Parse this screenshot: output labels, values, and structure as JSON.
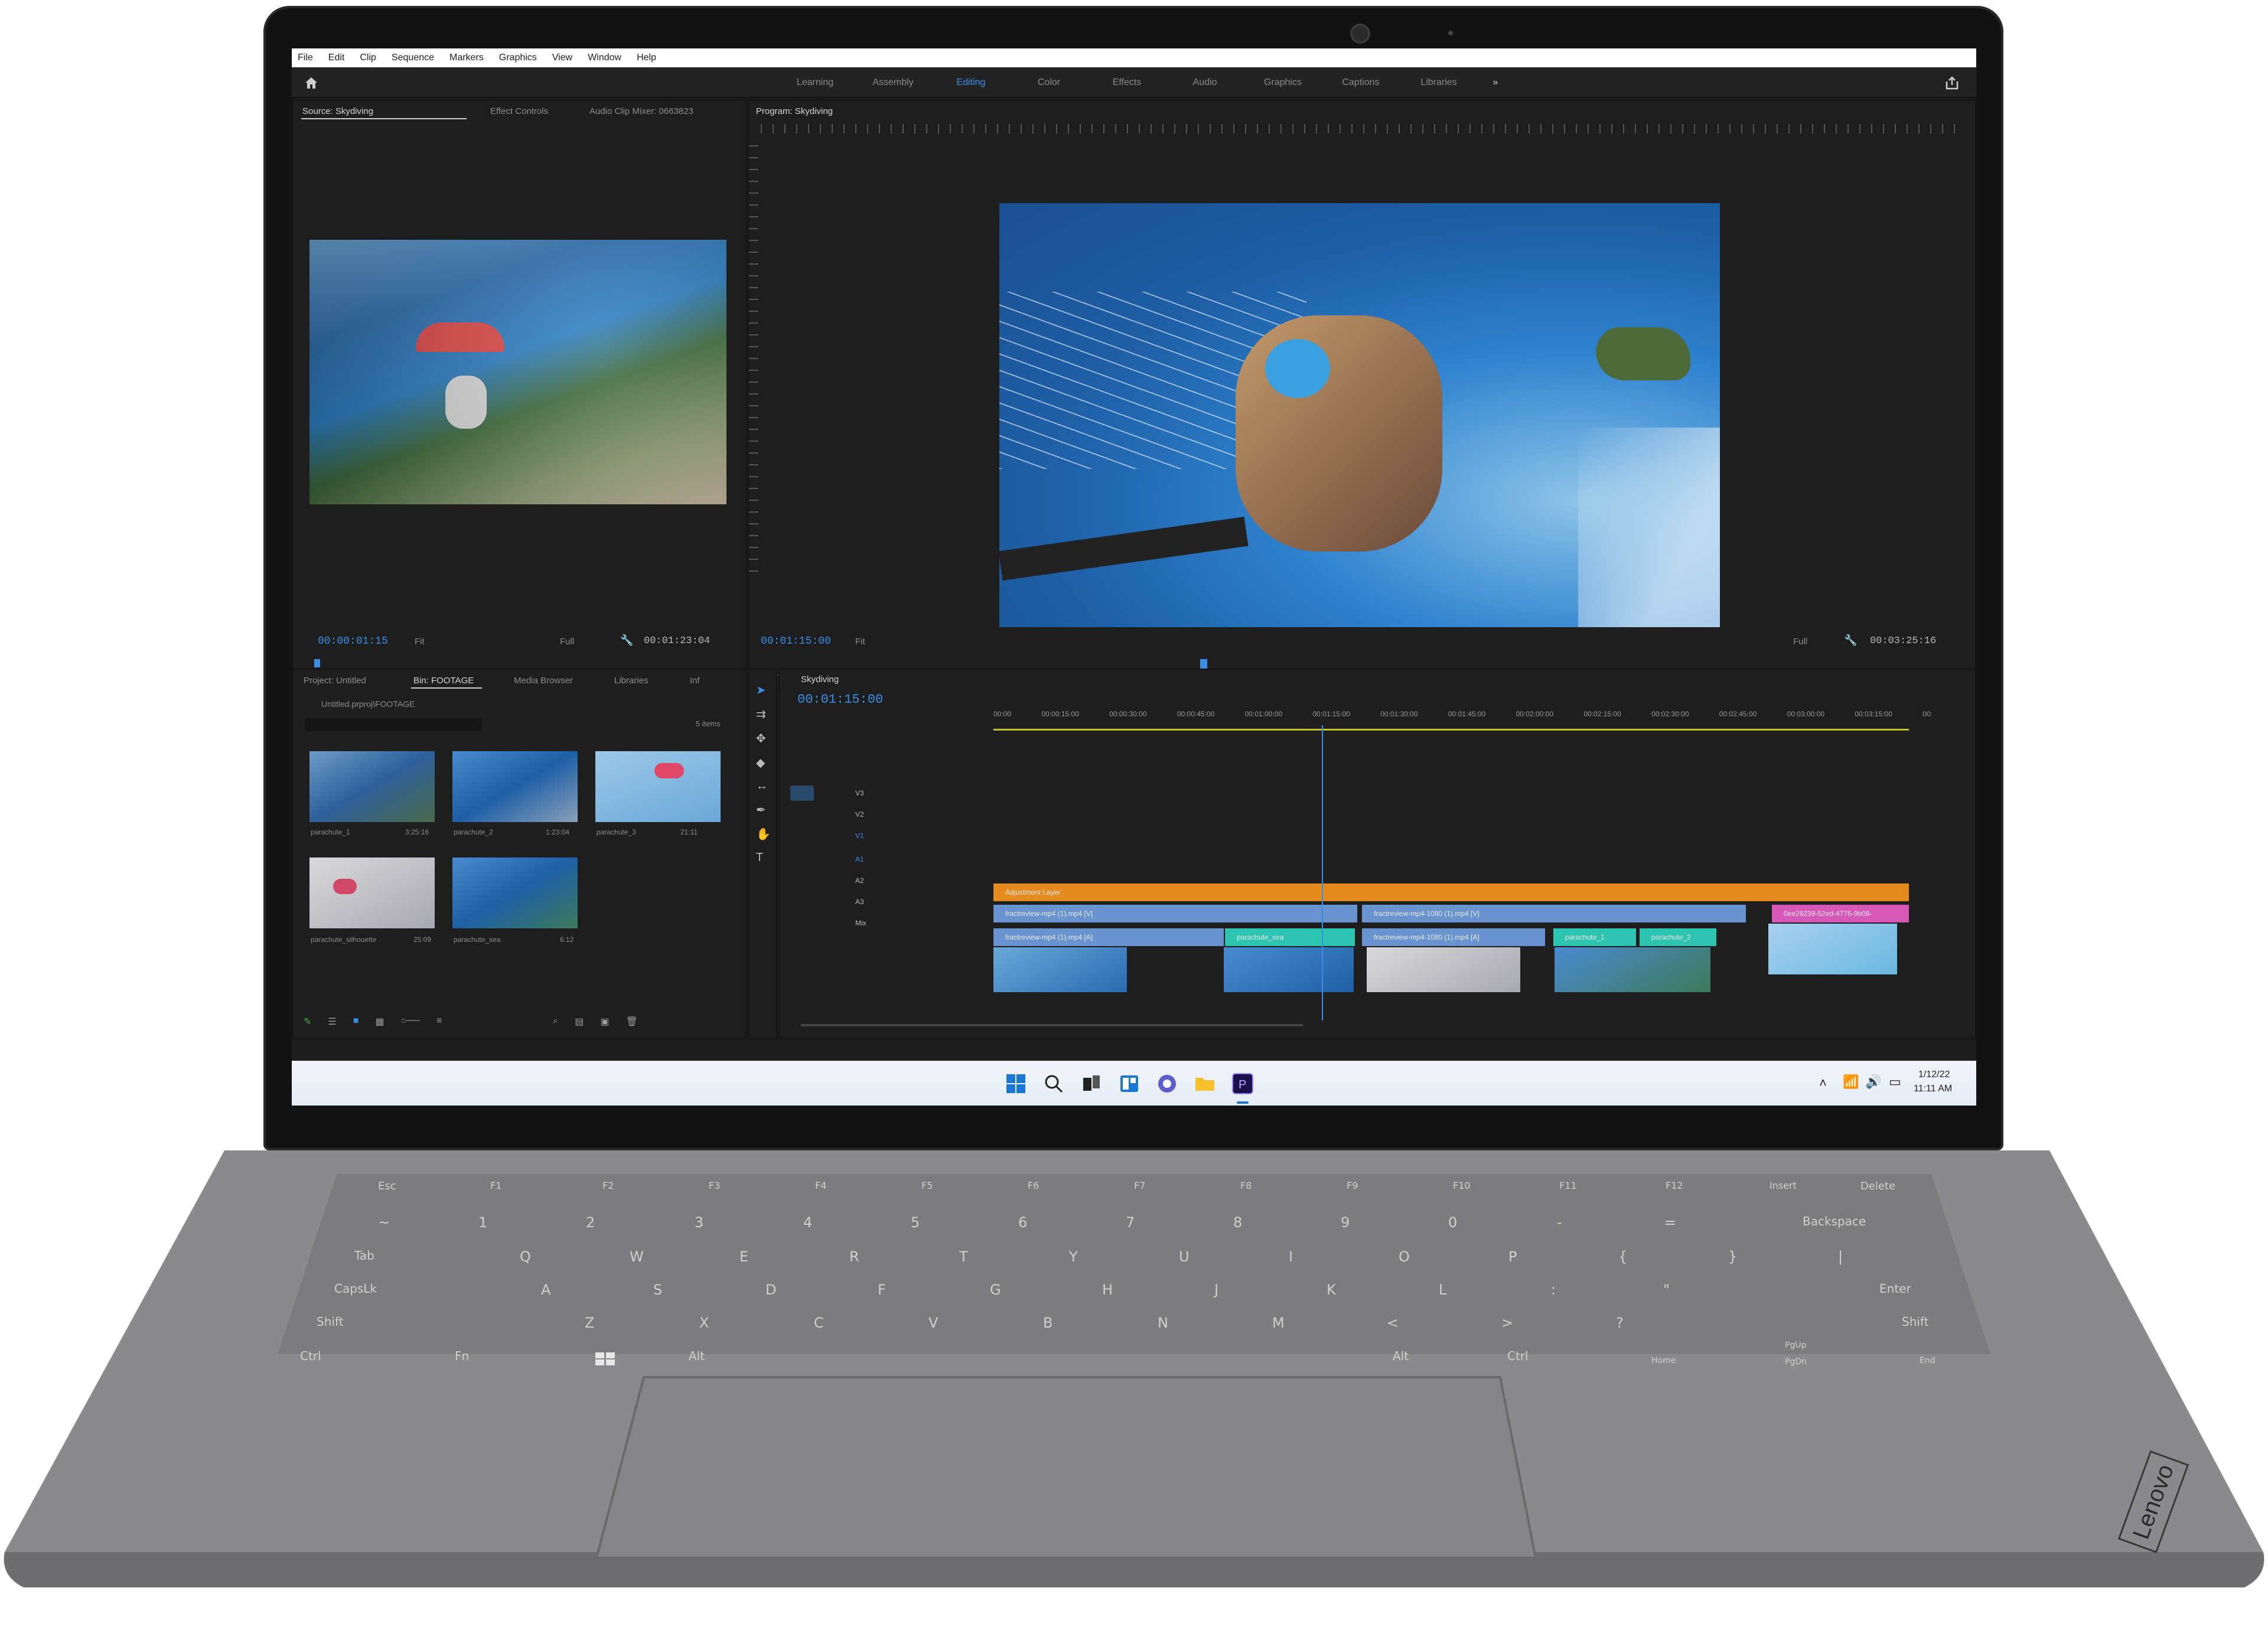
{
  "menu": [
    "File",
    "Edit",
    "Clip",
    "Sequence",
    "Markers",
    "Graphics",
    "View",
    "Window",
    "Help"
  ],
  "workspaces": [
    "Learning",
    "Assembly",
    "Editing",
    "Color",
    "Effects",
    "Audio",
    "Graphics",
    "Captions",
    "Libraries"
  ],
  "workspace_active": "Editing",
  "source_panel": {
    "tabs": [
      "Source: Skydiving",
      "Effect Controls",
      "Audio Clip Mixer: 0663823"
    ],
    "timecode": "00:00:01:15",
    "fit": "Fit",
    "quality": "Full",
    "duration": "00:01:23:04"
  },
  "program_panel": {
    "tab": "Program: Skydiving",
    "timecode": "00:01:15:00",
    "fit": "Fit",
    "quality": "Full",
    "duration": "00:03:25:16"
  },
  "project_panel": {
    "tabs": [
      "Project: Untitled",
      "Bin: FOOTAGE",
      "Media Browser",
      "Libraries",
      "Inf"
    ],
    "path": "Untitled.prproj\\FOOTAGE",
    "item_count": "5 items",
    "items": [
      {
        "name": "parachute_1",
        "duration": "3:25:16"
      },
      {
        "name": "parachute_2",
        "duration": "1:23:04"
      },
      {
        "name": "parachute_3",
        "duration": "21:11"
      },
      {
        "name": "parachute_silhouette",
        "duration": "25:09"
      },
      {
        "name": "parachute_sea",
        "duration": "6:12"
      }
    ]
  },
  "timeline": {
    "sequence": "Skydiving",
    "timecode": "00:01:15:00",
    "ruler": [
      "00:00",
      "00:00:15:00",
      "00:00:30:00",
      "00:00:45:00",
      "00:01:00:00",
      "00:01:15:00",
      "00:01:30:00",
      "00:01:45:00",
      "00:02:00:00",
      "00:02:15:00",
      "00:02:30:00",
      "00:02:45:00",
      "00:03:00:00",
      "00:03:15:00",
      "00:"
    ],
    "tracks": [
      "V3",
      "V2",
      "V1",
      "A1",
      "A2",
      "A3",
      "Mix"
    ],
    "clips": {
      "adjustment": "Adjustment Layer",
      "v1a": "fractreview-mp4 (1).mp4 [V]",
      "v1b": "fractreview-mp4-1080 (1).mp4 [V]",
      "v1c": "0ee28239-52ed-4776-9b09-",
      "a1a": "fractreview-mp4 (1).mp4 [A]",
      "a1b": "parachute_sea",
      "a1c": "fractreview-mp4-1080 (1).mp4 [A]",
      "a1d": "parachute_1",
      "a1e": "parachute_2"
    }
  },
  "taskbar": {
    "date": "1/12/22",
    "time": "11:11 AM"
  },
  "keyboard": {
    "fn_row": [
      "Esc",
      "F1",
      "F2",
      "F3",
      "F4",
      "F5",
      "F6",
      "F7",
      "F8",
      "F9",
      "F10",
      "F11",
      "F12",
      "Insert",
      "Delete"
    ],
    "num_row": [
      "~",
      "1",
      "2",
      "3",
      "4",
      "5",
      "6",
      "7",
      "8",
      "9",
      "0",
      "-",
      "=",
      "Backspace"
    ],
    "qwerty": [
      "Tab",
      "Q",
      "W",
      "E",
      "R",
      "T",
      "Y",
      "U",
      "I",
      "O",
      "P",
      "{",
      "}",
      "|"
    ],
    "asdf": [
      "CapsLk",
      "A",
      "S",
      "D",
      "F",
      "G",
      "H",
      "J",
      "K",
      "L",
      ":",
      "\"",
      "Enter"
    ],
    "zxcv": [
      "Shift",
      "Z",
      "X",
      "C",
      "V",
      "B",
      "N",
      "M",
      "<",
      ">",
      "?",
      "Shift"
    ],
    "bottom": [
      "Ctrl",
      "Fn",
      "Alt",
      "Alt",
      "Ctrl",
      "Home",
      "PgUp",
      "PgDn",
      "End"
    ]
  },
  "brand": "Lenovo"
}
